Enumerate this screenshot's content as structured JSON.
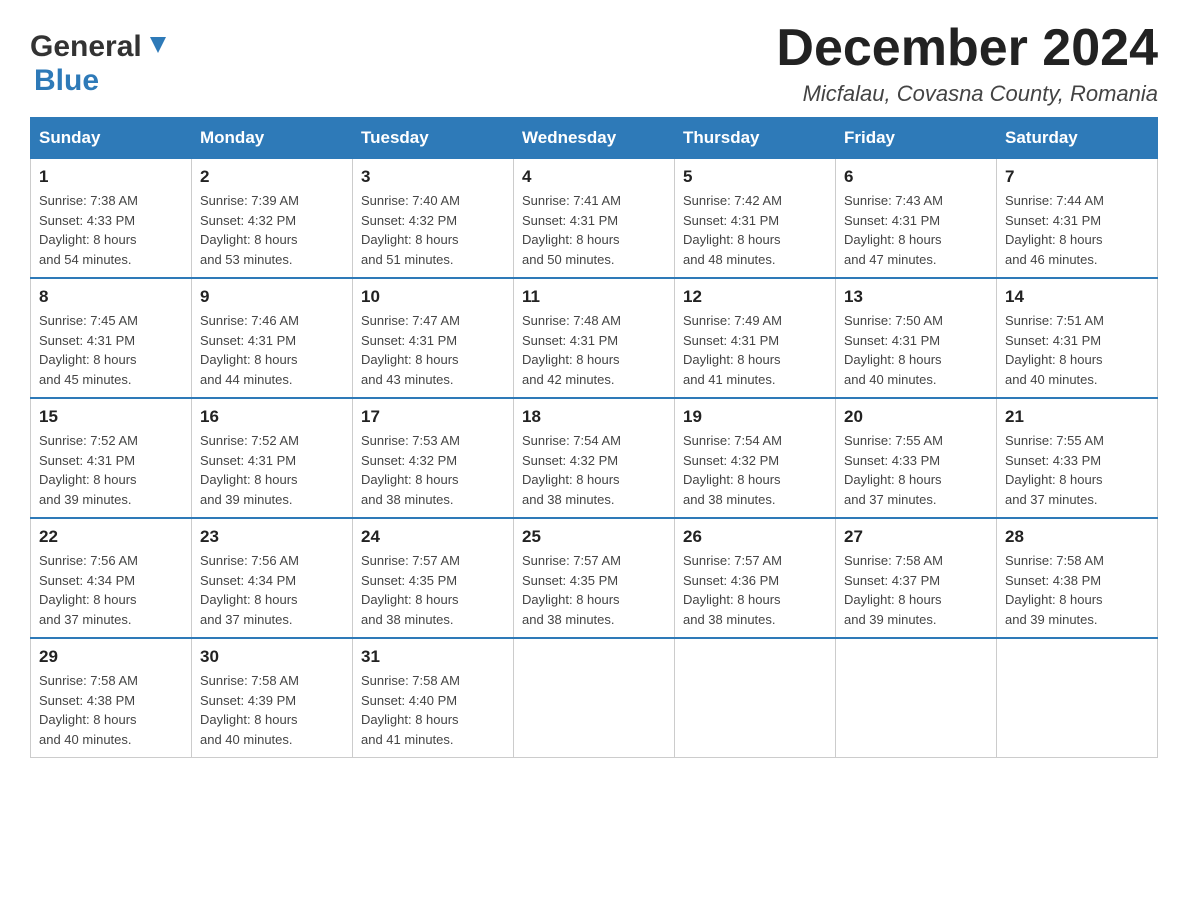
{
  "header": {
    "logo_general": "General",
    "logo_blue": "Blue",
    "month_year": "December 2024",
    "location": "Micfalau, Covasna County, Romania"
  },
  "weekdays": [
    "Sunday",
    "Monday",
    "Tuesday",
    "Wednesday",
    "Thursday",
    "Friday",
    "Saturday"
  ],
  "weeks": [
    [
      {
        "day": "1",
        "sunrise": "7:38 AM",
        "sunset": "4:33 PM",
        "daylight": "8 hours and 54 minutes."
      },
      {
        "day": "2",
        "sunrise": "7:39 AM",
        "sunset": "4:32 PM",
        "daylight": "8 hours and 53 minutes."
      },
      {
        "day": "3",
        "sunrise": "7:40 AM",
        "sunset": "4:32 PM",
        "daylight": "8 hours and 51 minutes."
      },
      {
        "day": "4",
        "sunrise": "7:41 AM",
        "sunset": "4:31 PM",
        "daylight": "8 hours and 50 minutes."
      },
      {
        "day": "5",
        "sunrise": "7:42 AM",
        "sunset": "4:31 PM",
        "daylight": "8 hours and 48 minutes."
      },
      {
        "day": "6",
        "sunrise": "7:43 AM",
        "sunset": "4:31 PM",
        "daylight": "8 hours and 47 minutes."
      },
      {
        "day": "7",
        "sunrise": "7:44 AM",
        "sunset": "4:31 PM",
        "daylight": "8 hours and 46 minutes."
      }
    ],
    [
      {
        "day": "8",
        "sunrise": "7:45 AM",
        "sunset": "4:31 PM",
        "daylight": "8 hours and 45 minutes."
      },
      {
        "day": "9",
        "sunrise": "7:46 AM",
        "sunset": "4:31 PM",
        "daylight": "8 hours and 44 minutes."
      },
      {
        "day": "10",
        "sunrise": "7:47 AM",
        "sunset": "4:31 PM",
        "daylight": "8 hours and 43 minutes."
      },
      {
        "day": "11",
        "sunrise": "7:48 AM",
        "sunset": "4:31 PM",
        "daylight": "8 hours and 42 minutes."
      },
      {
        "day": "12",
        "sunrise": "7:49 AM",
        "sunset": "4:31 PM",
        "daylight": "8 hours and 41 minutes."
      },
      {
        "day": "13",
        "sunrise": "7:50 AM",
        "sunset": "4:31 PM",
        "daylight": "8 hours and 40 minutes."
      },
      {
        "day": "14",
        "sunrise": "7:51 AM",
        "sunset": "4:31 PM",
        "daylight": "8 hours and 40 minutes."
      }
    ],
    [
      {
        "day": "15",
        "sunrise": "7:52 AM",
        "sunset": "4:31 PM",
        "daylight": "8 hours and 39 minutes."
      },
      {
        "day": "16",
        "sunrise": "7:52 AM",
        "sunset": "4:31 PM",
        "daylight": "8 hours and 39 minutes."
      },
      {
        "day": "17",
        "sunrise": "7:53 AM",
        "sunset": "4:32 PM",
        "daylight": "8 hours and 38 minutes."
      },
      {
        "day": "18",
        "sunrise": "7:54 AM",
        "sunset": "4:32 PM",
        "daylight": "8 hours and 38 minutes."
      },
      {
        "day": "19",
        "sunrise": "7:54 AM",
        "sunset": "4:32 PM",
        "daylight": "8 hours and 38 minutes."
      },
      {
        "day": "20",
        "sunrise": "7:55 AM",
        "sunset": "4:33 PM",
        "daylight": "8 hours and 37 minutes."
      },
      {
        "day": "21",
        "sunrise": "7:55 AM",
        "sunset": "4:33 PM",
        "daylight": "8 hours and 37 minutes."
      }
    ],
    [
      {
        "day": "22",
        "sunrise": "7:56 AM",
        "sunset": "4:34 PM",
        "daylight": "8 hours and 37 minutes."
      },
      {
        "day": "23",
        "sunrise": "7:56 AM",
        "sunset": "4:34 PM",
        "daylight": "8 hours and 37 minutes."
      },
      {
        "day": "24",
        "sunrise": "7:57 AM",
        "sunset": "4:35 PM",
        "daylight": "8 hours and 38 minutes."
      },
      {
        "day": "25",
        "sunrise": "7:57 AM",
        "sunset": "4:35 PM",
        "daylight": "8 hours and 38 minutes."
      },
      {
        "day": "26",
        "sunrise": "7:57 AM",
        "sunset": "4:36 PM",
        "daylight": "8 hours and 38 minutes."
      },
      {
        "day": "27",
        "sunrise": "7:58 AM",
        "sunset": "4:37 PM",
        "daylight": "8 hours and 39 minutes."
      },
      {
        "day": "28",
        "sunrise": "7:58 AM",
        "sunset": "4:38 PM",
        "daylight": "8 hours and 39 minutes."
      }
    ],
    [
      {
        "day": "29",
        "sunrise": "7:58 AM",
        "sunset": "4:38 PM",
        "daylight": "8 hours and 40 minutes."
      },
      {
        "day": "30",
        "sunrise": "7:58 AM",
        "sunset": "4:39 PM",
        "daylight": "8 hours and 40 minutes."
      },
      {
        "day": "31",
        "sunrise": "7:58 AM",
        "sunset": "4:40 PM",
        "daylight": "8 hours and 41 minutes."
      },
      null,
      null,
      null,
      null
    ]
  ],
  "labels": {
    "sunrise": "Sunrise:",
    "sunset": "Sunset:",
    "daylight": "Daylight:"
  }
}
